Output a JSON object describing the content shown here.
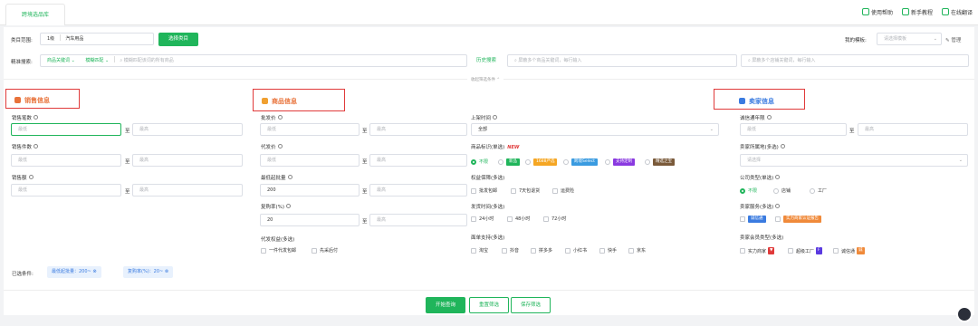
{
  "tab": {
    "label": "跨境选品库"
  },
  "toplinks": [
    "使用帮助",
    "新手教程",
    "在线翻译"
  ],
  "category": {
    "label": "类目范围:",
    "level": "1级",
    "value": "汽车用品",
    "button": "选择类目"
  },
  "template": {
    "label": "我的模板:",
    "placeholder": "请选择模板",
    "manage": "管理"
  },
  "search": {
    "label": "精准搜索:",
    "type": "商品关键词",
    "match": "模糊匹配",
    "placeholder": "模糊匹配该词的所有商品",
    "history": "历史搜索",
    "goods_placeholder": "屏蔽多个商品关键词，每行输入",
    "shop_placeholder": "屏蔽多个店铺关键词，每行输入"
  },
  "collapse": "收起筛选条件",
  "sections": {
    "sales": "销售信息",
    "goods": "商品信息",
    "seller": "卖家信息"
  },
  "sales": {
    "count_label": "销售笔数",
    "pieces_label": "销售件数",
    "amount_label": "销售额",
    "min": "最低",
    "max": "最高",
    "to": "至"
  },
  "goods": {
    "wholesale_label": "批发价",
    "dropship_label": "代发价",
    "moq_label": "最低起批量",
    "moq_value": "200",
    "repurchase_label": "复购率(%)",
    "repurchase_value": "20",
    "rights_label": "代发权益(多选)",
    "rights_options": [
      "一件代发包邮",
      "先采后付"
    ]
  },
  "listing": {
    "time_label": "上架时间",
    "time_value": "全部",
    "mark_label": "商品标识(单选)",
    "new_badge": "NEW",
    "mark_options": [
      "不限",
      "新品",
      "1688严选",
      "跨境Select",
      "支持定制",
      "精选之宝"
    ],
    "guarantee_label": "权益保障(多选)",
    "guarantee_options": [
      "批发包邮",
      "7天包退货",
      "运费险"
    ],
    "ship_label": "发货时间(多选)",
    "ship_options": [
      "24小时",
      "48小时",
      "72小时"
    ],
    "platform_label": "面单支持(多选)",
    "platform_options": [
      "淘宝",
      "抖音",
      "拼多多",
      "小红书",
      "快手",
      "京东"
    ]
  },
  "seller": {
    "years_label": "诚信通年限",
    "region_label": "卖家所属地(多选)",
    "region_placeholder": "请选择",
    "type_label": "公司类型(单选)",
    "type_options": [
      "不限",
      "店铺",
      "工厂"
    ],
    "service_label": "卖家服务(多选)",
    "service_options": [
      "诚信通",
      "实力商家认证报告"
    ],
    "member_label": "卖家会员类型(多选)",
    "member_options": [
      "实力商家",
      "超级工厂",
      "诚信通"
    ]
  },
  "selected": {
    "label": "已选条件:",
    "chips": [
      "最低起批量：200~",
      "复购率(%)：20~"
    ]
  },
  "actions": {
    "query": "开始查询",
    "reset": "重置筛选",
    "save": "保存筛选"
  },
  "colors": {
    "accent": "#20b55b",
    "section": "#e8723a",
    "highlight": "#e03a3a"
  }
}
